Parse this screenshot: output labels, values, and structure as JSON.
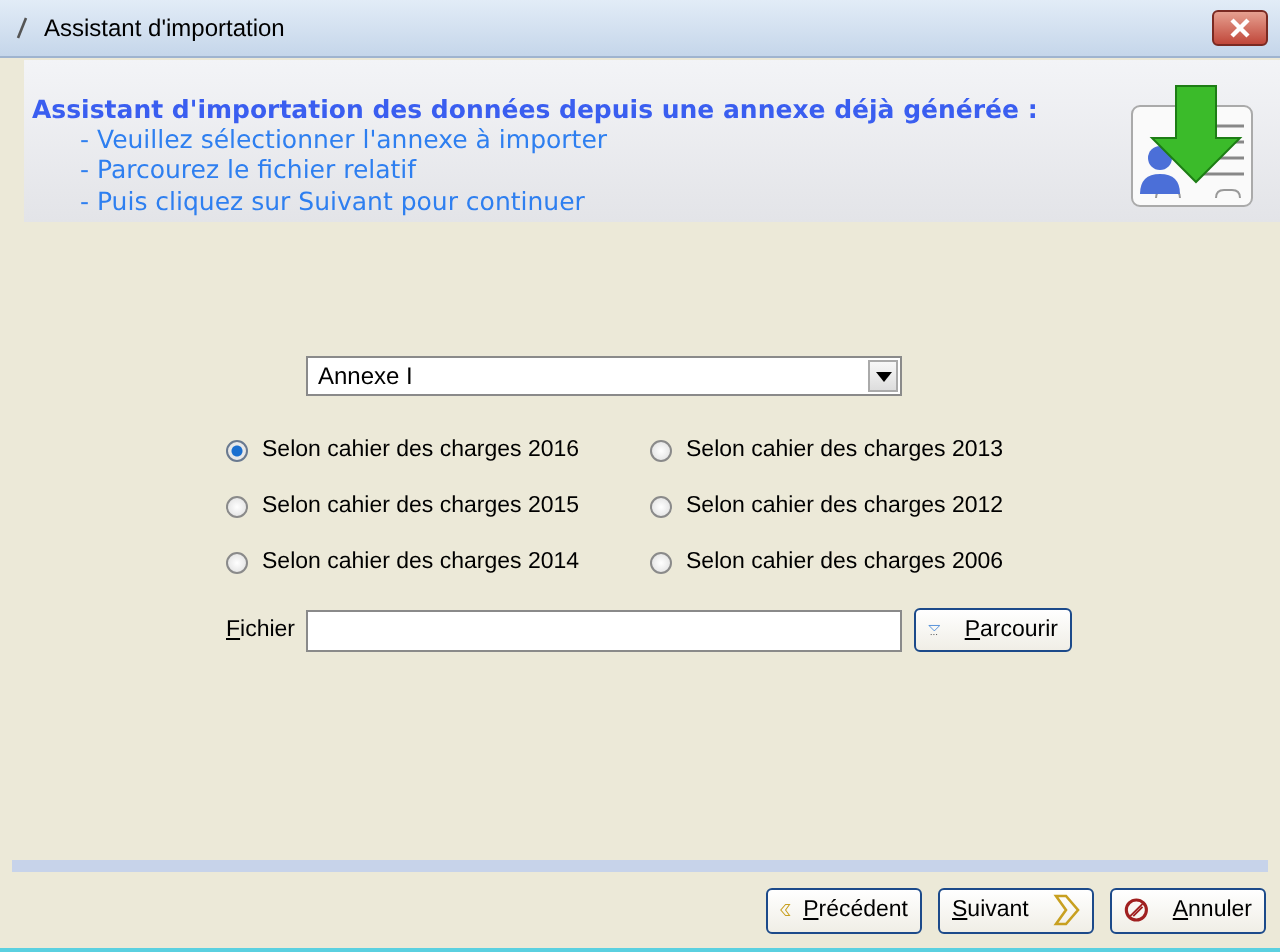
{
  "window": {
    "title": "Assistant d'importation"
  },
  "header": {
    "title": "Assistant d'importation des données depuis une annexe déjà générée :",
    "steps": [
      "- Veuillez sélectionner l'annexe à importer",
      "- Parcourez le fichier relatif",
      "- Puis cliquez sur Suivant pour continuer"
    ]
  },
  "annex_select": {
    "value": "Annexe I"
  },
  "options": [
    {
      "label": "Selon cahier des charges 2016",
      "selected": true
    },
    {
      "label": "Selon cahier des charges 2013",
      "selected": false
    },
    {
      "label": "Selon cahier des charges 2015",
      "selected": false
    },
    {
      "label": "Selon cahier des charges 2012",
      "selected": false
    },
    {
      "label": "Selon cahier des charges 2014",
      "selected": false
    },
    {
      "label": "Selon cahier des charges 2006",
      "selected": false
    }
  ],
  "file": {
    "label": "Fichier",
    "browse_button": "Parcourir"
  },
  "buttons": [
    {
      "kind": "previous",
      "label": "Précédent"
    },
    {
      "kind": "next",
      "label": "Suivant"
    },
    {
      "kind": "cancel",
      "label": "Annuler"
    }
  ]
}
